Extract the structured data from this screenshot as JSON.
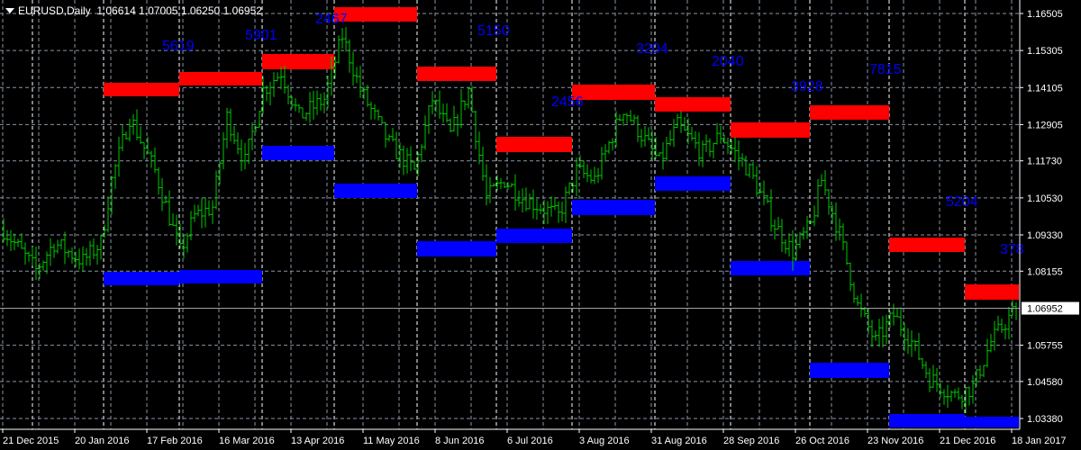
{
  "header": {
    "symbol": "EURUSD,Daily",
    "open": "1.06614",
    "high": "1.07005",
    "low": "1.06250",
    "close": "1.06952"
  },
  "colors": {
    "background": "#000000",
    "bars": "#00c800",
    "resistance": "#ff0000",
    "support": "#0000ff",
    "labels": "#0000ff",
    "grid": "#8a95a5",
    "axis": "#ffffff"
  },
  "chart_data": {
    "type": "bar",
    "title": "EURUSD,Daily",
    "ylim": [
      1.0338,
      1.16505
    ],
    "y_ticks": [
      "1.16505",
      "1.15305",
      "1.14105",
      "1.12905",
      "1.11730",
      "1.10530",
      "1.09330",
      "1.08155",
      "1.05755",
      "1.04580",
      "1.03380"
    ],
    "current_price": "1.06952",
    "x_ticks": [
      "21 Dec 2015",
      "20 Jan 2016",
      "17 Feb 2016",
      "16 Mar 2016",
      "13 Apr 2016",
      "11 May 2016",
      "8 Jun 2016",
      "6 Jul 2016",
      "3 Aug 2016",
      "31 Aug 2016",
      "28 Sep 2016",
      "26 Oct 2016",
      "23 Nov 2016",
      "21 Dec 2016",
      "18 Jan 2017"
    ],
    "bars_per_tick": 20,
    "close_path": [
      [
        0,
        1.095
      ],
      [
        9,
        1.0819
      ],
      [
        14,
        1.0907
      ],
      [
        22,
        1.0848
      ],
      [
        27,
        1.0907
      ],
      [
        30,
        1.1111
      ],
      [
        35,
        1.1315
      ],
      [
        42,
        1.114
      ],
      [
        49,
        1.0878
      ],
      [
        53,
        1.0994
      ],
      [
        58,
        1.1023
      ],
      [
        62,
        1.1315
      ],
      [
        67,
        1.1169
      ],
      [
        72,
        1.1403
      ],
      [
        77,
        1.1461
      ],
      [
        82,
        1.1315
      ],
      [
        89,
        1.1373
      ],
      [
        94,
        1.1578
      ],
      [
        99,
        1.1403
      ],
      [
        107,
        1.1228
      ],
      [
        114,
        1.114
      ],
      [
        119,
        1.1373
      ],
      [
        124,
        1.1257
      ],
      [
        129,
        1.1403
      ],
      [
        134,
        1.1053
      ],
      [
        139,
        1.1111
      ],
      [
        144,
        1.1053
      ],
      [
        154,
        1.0994
      ],
      [
        159,
        1.114
      ],
      [
        164,
        1.1111
      ],
      [
        172,
        1.1344
      ],
      [
        177,
        1.1257
      ],
      [
        182,
        1.1169
      ],
      [
        187,
        1.1286
      ],
      [
        194,
        1.1198
      ],
      [
        199,
        1.1257
      ],
      [
        207,
        1.114
      ],
      [
        214,
        1.0965
      ],
      [
        219,
        1.0878
      ],
      [
        224,
        1.0965
      ],
      [
        227,
        1.1111
      ],
      [
        232,
        1.0936
      ],
      [
        237,
        1.0703
      ],
      [
        242,
        1.0586
      ],
      [
        247,
        1.0673
      ],
      [
        252,
        1.0586
      ],
      [
        257,
        1.0469
      ],
      [
        264,
        1.0411
      ],
      [
        269,
        1.044
      ],
      [
        274,
        1.0586
      ],
      [
        281,
        1.06952
      ]
    ],
    "zones": [
      {
        "start": 28,
        "end": 49,
        "res": [
          1.14259,
          1.13822
        ],
        "sup": [
          1.08134,
          1.07696
        ],
        "label": "5619"
      },
      {
        "start": 49,
        "end": 72,
        "res": [
          1.14609,
          1.14172
        ],
        "sup": [
          1.08192,
          1.07755
        ],
        "label": "5901"
      },
      {
        "start": 72,
        "end": 92,
        "res": [
          1.15193,
          1.14697
        ],
        "sup": [
          1.12217,
          1.11751
        ],
        "label": "2467"
      },
      {
        "start": 92,
        "end": 115,
        "res": [
          1.16709,
          1.16242
        ],
        "sup": [
          1.10992,
          1.10526
        ],
        "label": "5150"
      },
      {
        "start": 115,
        "end": 137,
        "res": [
          1.14784,
          1.14318
        ],
        "sup": [
          1.09126,
          1.0863
        ],
        "label": "2456"
      },
      {
        "start": 137,
        "end": 158,
        "res": [
          1.12509,
          1.12013
        ],
        "sup": [
          1.09534,
          1.09068
        ],
        "label": "3204"
      },
      {
        "start": 158,
        "end": 181,
        "res": [
          1.14201,
          1.13705
        ],
        "sup": [
          1.10467,
          1.09972
        ],
        "label": "2040"
      },
      {
        "start": 181,
        "end": 202,
        "res": [
          1.13793,
          1.13326
        ],
        "sup": [
          1.11226,
          1.10759
        ],
        "label": "3928"
      },
      {
        "start": 202,
        "end": 224,
        "res": [
          1.12976,
          1.1248
        ],
        "sup": [
          1.08484,
          1.08017
        ],
        "label": "7815"
      },
      {
        "start": 224,
        "end": 246,
        "res": [
          1.1353,
          1.13063
        ],
        "sup": [
          1.05188,
          1.04692
        ],
        "label": "5204"
      },
      {
        "start": 246,
        "end": 267,
        "res": [
          1.09242,
          1.08776
        ],
        "sup": [
          1.03525,
          1.03088
        ],
        "label": "378"
      },
      {
        "start": 267,
        "end": 282,
        "res": [
          1.07725,
          1.0723
        ],
        "sup": [
          1.03438,
          1.03088
        ],
        "label": ""
      }
    ]
  }
}
